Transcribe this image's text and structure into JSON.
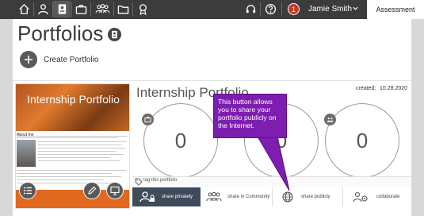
{
  "topbar": {
    "nav_icons": [
      "home-icon",
      "user-icon",
      "portfolio-icon",
      "briefcase-icon",
      "community-icon",
      "folder-icon",
      "award-icon"
    ],
    "right_icons": [
      "headset-icon",
      "help-icon"
    ],
    "notification_count": "1",
    "user_name": "Jamie Smith",
    "assessment_label": "Assessment"
  },
  "page": {
    "title": "Portfolios",
    "create_label": "Create Portfolio"
  },
  "portfolio": {
    "thumb_title": "Internship Portfolio",
    "thumb_about": "About me",
    "title": "Internship Portfolio",
    "created_label": "created:",
    "created_date": "10.28.2020",
    "counts": [
      "0",
      "0",
      "0"
    ],
    "tag_placeholder": "tag this portfolio"
  },
  "share": {
    "private": "share privately",
    "community": "share in Community",
    "public": "share publicly",
    "collaborate": "collaborate"
  },
  "tooltip": {
    "text": "This button allows you to share your portfolio publicly on the Internet."
  },
  "colors": {
    "topbar": "#3c3c3c",
    "thumb_accent": "#e0681f",
    "tooltip": "#7d1eb0",
    "share_active": "#3f4a5b",
    "notification": "#c0392b"
  }
}
